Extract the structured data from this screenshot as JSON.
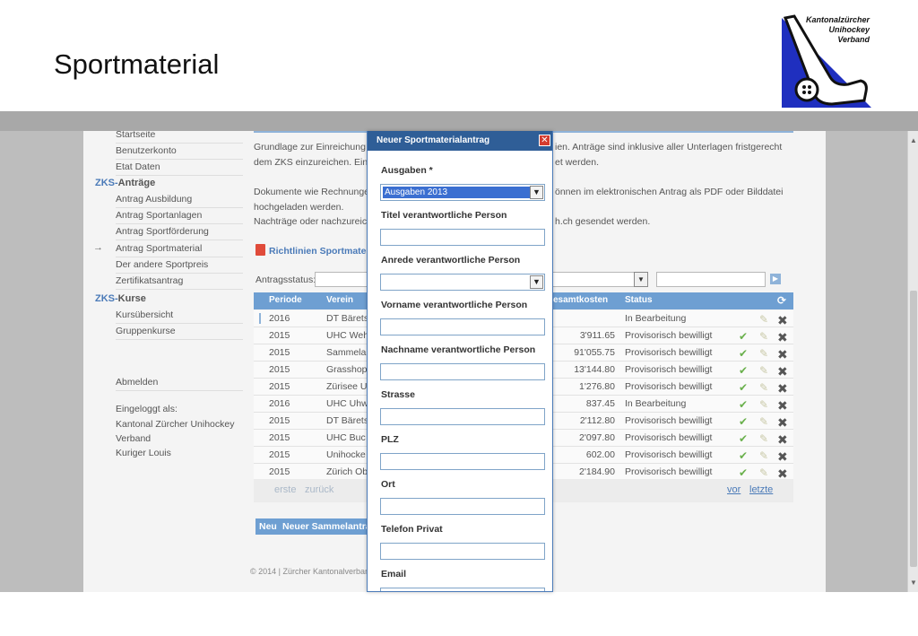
{
  "slide": {
    "title": "Sportmaterial"
  },
  "logo": {
    "line1": "Kantonalzürcher",
    "line2": "Unihockey",
    "line3": "Verband"
  },
  "sidebar": {
    "top_items": [
      "Startseite",
      "Benutzerkonto",
      "Etat Daten"
    ],
    "antraege_zks": "ZKS-",
    "antraege_label": "Anträge",
    "antraege_items": [
      "Antrag Ausbildung",
      "Antrag Sportanlagen",
      "Antrag Sportförderung",
      "Antrag Sportmaterial",
      "Der andere Sportpreis",
      "Zertifikatsantrag"
    ],
    "current_arrow": "→",
    "kurse_zks": "ZKS-",
    "kurse_label": "Kurse",
    "kurse_items": [
      "Kursübersicht",
      "Gruppenkurse"
    ],
    "logout": "Abmelden",
    "logged_in_label": "Eingeloggt als:",
    "logged_in_org1": "Kantonal Zürcher Unihockey",
    "logged_in_org2": "Verband",
    "logged_in_user": "Kuriger Louis"
  },
  "main": {
    "para1_l1_a": "Grundlage zur Einreichung",
    "para1_l1_b": "ien. Anträge sind inklusive aller Unterlagen fristgerecht",
    "para1_l2_a": "dem ZKS einzureichen. Ein",
    "para1_l2_b": "et werden.",
    "para2_l1_a": "Dokumente wie Rechnunge",
    "para2_l1_b": "önnen im elektronischen Antrag als PDF oder Bilddatei",
    "para2_l2": "hochgeladen werden.",
    "para2_l3_a": "Nachträge oder nachzureic",
    "para2_l3_b": "h.ch gesendet werden.",
    "pdf_link": "Richtlinien Sportmater",
    "status_label": "Antragsstatus:",
    "dropdown_arrow": "▼",
    "go_arrow": "▶",
    "table": {
      "headers": {
        "periode": "Periode",
        "verein": "Verein",
        "kosten": "esamtkosten",
        "status": "Status",
        "refresh": "⟳"
      },
      "rows": [
        {
          "periode": "2016",
          "verein": "DT Bärets",
          "kosten": "",
          "status": "In Bearbeitung",
          "check": "",
          "pen": "✎",
          "del": "✖"
        },
        {
          "periode": "2015",
          "verein": "UHC Weh",
          "kosten": "3'911.65",
          "status": "Provisorisch bewilligt",
          "check": "✔",
          "pen": "✎",
          "del": "✖"
        },
        {
          "periode": "2015",
          "verein": "Sammela",
          "kosten": "91'055.75",
          "status": "Provisorisch bewilligt",
          "check": "✔",
          "pen": "✎",
          "del": "✖"
        },
        {
          "periode": "2015",
          "verein": "Grasshop",
          "kosten": "13'144.80",
          "status": "Provisorisch bewilligt",
          "check": "✔",
          "pen": "✎",
          "del": "✖"
        },
        {
          "periode": "2015",
          "verein": "Zürisee U",
          "kosten": "1'276.80",
          "status": "Provisorisch bewilligt",
          "check": "✔",
          "pen": "✎",
          "del": "✖"
        },
        {
          "periode": "2016",
          "verein": "UHC Uhw",
          "kosten": "837.45",
          "status": "In Bearbeitung",
          "check": "✔",
          "pen": "✎",
          "del": "✖"
        },
        {
          "periode": "2015",
          "verein": "DT Bärets",
          "kosten": "2'112.80",
          "status": "Provisorisch bewilligt",
          "check": "✔",
          "pen": "✎",
          "del": "✖"
        },
        {
          "periode": "2015",
          "verein": "UHC Buc",
          "kosten": "2'097.80",
          "status": "Provisorisch bewilligt",
          "check": "✔",
          "pen": "✎",
          "del": "✖"
        },
        {
          "periode": "2015",
          "verein": "Unihocke",
          "kosten": "602.00",
          "status": "Provisorisch bewilligt",
          "check": "✔",
          "pen": "✎",
          "del": "✖"
        },
        {
          "periode": "2015",
          "verein": "Zürich Ob",
          "kosten": "2'184.90",
          "status": "Provisorisch bewilligt",
          "check": "✔",
          "pen": "✎",
          "del": "✖"
        }
      ]
    },
    "pager": {
      "first": "erste",
      "back": "zurück",
      "next": "vor",
      "last": "letzte"
    },
    "btn_new": "Neu",
    "btn_new_collection": "Neuer Sammelantra",
    "footer": "© 2014 | Zürcher Kantonalverband"
  },
  "modal": {
    "title": "Neuer Sportmaterialantrag",
    "close": "✕",
    "ausgaben_label": "Ausgaben *",
    "ausgaben_value": "Ausgaben 2013",
    "titel_label": "Titel verantwortliche Person",
    "anrede_label": "Anrede verantwortliche Person",
    "vorname_label": "Vorname verantwortliche Person",
    "nachname_label": "Nachname verantwortliche Person",
    "strasse_label": "Strasse",
    "plz_label": "PLZ",
    "ort_label": "Ort",
    "telefon_label": "Telefon Privat",
    "email_label": "Email",
    "dropdown_arrow": "▼"
  },
  "colors": {
    "accent": "#6e9fd2",
    "modal_header": "#2f5e97",
    "logo_blue": "#1f2fbf"
  }
}
